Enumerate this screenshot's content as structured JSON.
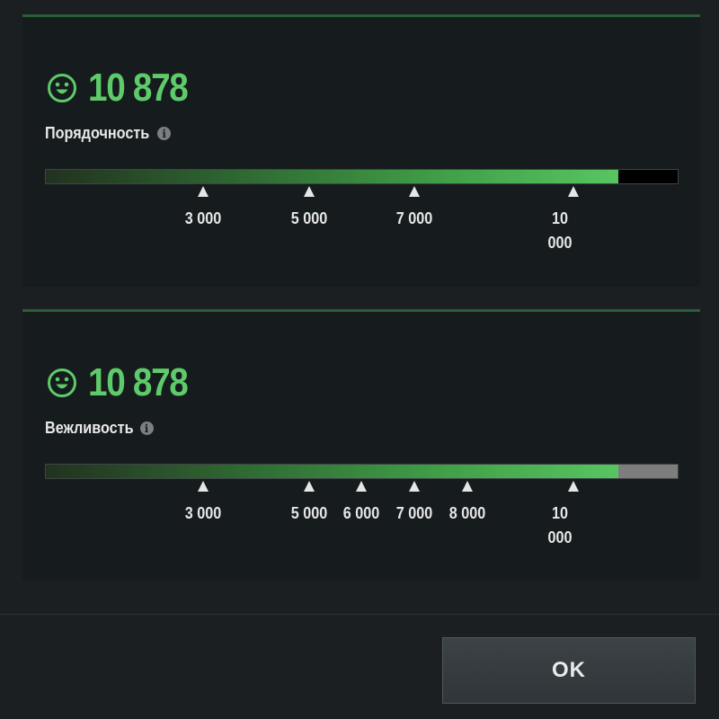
{
  "decency": {
    "score": "10 878",
    "label": "Порядочность",
    "info_icon": "info-icon",
    "progress_percent": 90.6,
    "milestones": [
      "3 000",
      "5 000",
      "7 000",
      "10 000"
    ]
  },
  "politeness": {
    "score": "10 878",
    "label": "Вежливость",
    "info_icon": "info-icon",
    "progress_percent": 90.6,
    "milestones": [
      "3 000",
      "5 000",
      "6 000",
      "7 000",
      "8 000",
      "10 000"
    ]
  },
  "footer": {
    "ok_label": "OK"
  },
  "colors": {
    "score_green": "#5ecb6a",
    "panel_bg": "#161b1e",
    "panel_accent": "#2b5e36",
    "bar_fill_end": "#57c561",
    "bar_track_1": "#000000",
    "bar_track_2": "#7d7d7d"
  },
  "icons": {
    "smiley": "smiley-icon",
    "info": "info-icon"
  }
}
